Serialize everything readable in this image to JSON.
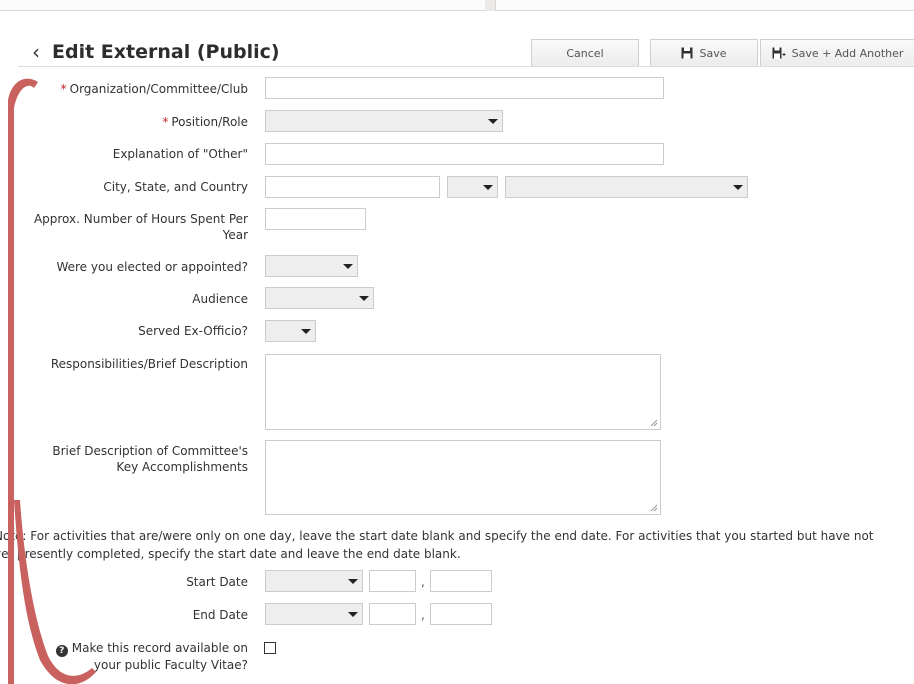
{
  "header": {
    "title": "Edit External (Public)",
    "cancel_label": "Cancel",
    "save_label": "Save",
    "save_add_label": "Save + Add Another"
  },
  "form": {
    "organization_label": "Organization/Committee/Club",
    "position_label": "Position/Role",
    "explanation_label": "Explanation of \"Other\"",
    "location_label": "City, State, and Country",
    "hours_label_line1": "Approx. Number of Hours Spent Per",
    "hours_label_line2": "Year",
    "elected_label": "Were you elected or appointed?",
    "audience_label": "Audience",
    "exofficio_label": "Served Ex-Officio?",
    "responsibilities_label": "Responsibilities/Brief Description",
    "accomplishments_label_line1": "Brief Description of Committee's",
    "accomplishments_label_line2": "Key Accomplishments",
    "note_line1": "Note: For activities that are/were only on one day, leave the start date blank and specify the end date. For activities that you started but have not",
    "note_line2": "yet presently completed, specify the start date and leave the end date blank.",
    "start_date_label": "Start Date",
    "end_date_label": "End Date",
    "comma": ",",
    "public_label_line1": "Make this record available on",
    "public_label_line2": "your public Faculty Vitae?"
  },
  "colors": {
    "required": "#c0262d",
    "ribbon": "#c9625e"
  }
}
